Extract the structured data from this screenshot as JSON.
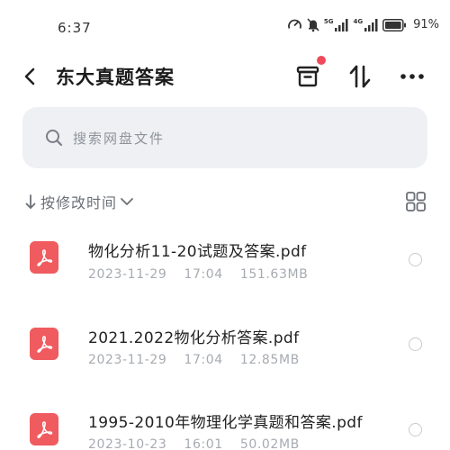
{
  "status_bar": {
    "time": "6:37",
    "network_labels": [
      "5G",
      "4G"
    ],
    "battery": "91%",
    "icons": [
      "speedometer-icon",
      "mute-bell-icon",
      "signal-5g-icon",
      "signal-4g-icon",
      "battery-icon"
    ]
  },
  "header": {
    "title": "东大真题答案",
    "icons": [
      "back-icon",
      "transfer-box-icon",
      "sort-arrows-icon",
      "more-icon"
    ],
    "notification_dot_color": "#f04a5a"
  },
  "search": {
    "placeholder": "搜索网盘文件"
  },
  "sort": {
    "label": "按修改时间",
    "icons": [
      "arrow-down-icon",
      "chevron-down-icon",
      "grid-view-icon"
    ]
  },
  "files": [
    {
      "name": "物化分析11-20试题及答案.pdf",
      "date": "2023-11-29",
      "time": "17:04",
      "size": "151.63MB",
      "icon": "pdf-icon"
    },
    {
      "name": "2021.2022物化分析答案.pdf",
      "date": "2023-11-29",
      "time": "17:04",
      "size": "12.85MB",
      "icon": "pdf-icon"
    },
    {
      "name": "1995-2010年物理化学真题和答案.pdf",
      "date": "2023-10-23",
      "time": "16:01",
      "size": "50.02MB",
      "icon": "pdf-icon"
    }
  ],
  "colors": {
    "pdf_icon": "#ef5b5f",
    "search_bg": "#eef0f4",
    "meta_text": "#a7abb1"
  }
}
